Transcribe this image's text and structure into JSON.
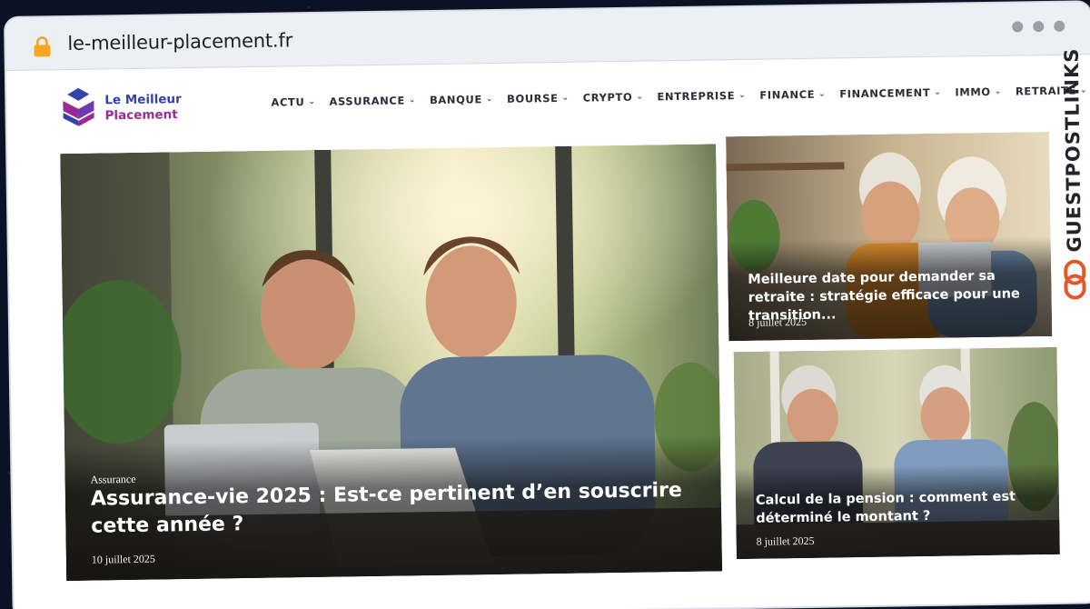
{
  "browser": {
    "url": "le-meilleur-placement.fr",
    "lock_icon": "lock-icon",
    "window_controls": [
      "dot",
      "dot",
      "dot"
    ]
  },
  "site": {
    "logo_line1": "Le Meilleur",
    "logo_line2": "Placement",
    "colors": {
      "blue": "#3640a8",
      "purple": "#9b2a97",
      "accent": "#e5562b"
    }
  },
  "nav": {
    "items": [
      {
        "label": "ACTU"
      },
      {
        "label": "ASSURANCE"
      },
      {
        "label": "BANQUE"
      },
      {
        "label": "BOURSE"
      },
      {
        "label": "CRYPTO"
      },
      {
        "label": "ENTREPRISE"
      },
      {
        "label": "FINANCE"
      },
      {
        "label": "FINANCEMENT"
      },
      {
        "label": "IMMO"
      },
      {
        "label": "RETRAITE"
      }
    ],
    "chevron": "⌄"
  },
  "articles": {
    "main": {
      "category": "Assurance",
      "title": "Assurance-vie 2025 : Est-ce pertinent d’en souscrire cette année ?",
      "date": "10 juillet 2025"
    },
    "side1": {
      "title": "Meilleure date pour demander sa retraite : stratégie efficace pour une transition...",
      "date": "8 juillet 2025"
    },
    "side2": {
      "title": "Calcul de la pension : comment est déterminé le montant ?",
      "date": "8 juillet 2025"
    }
  },
  "watermark": {
    "text": "GUESTPOSTLINKS",
    "icon": "link-icon"
  }
}
